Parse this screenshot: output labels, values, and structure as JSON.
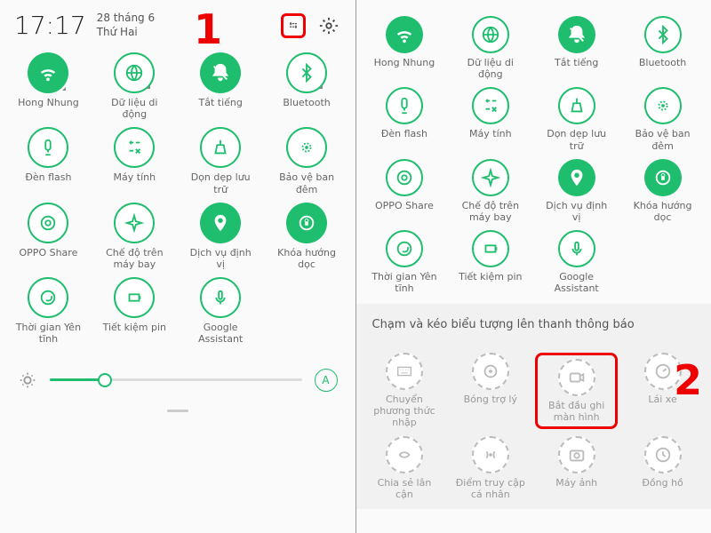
{
  "status": {
    "time": "17:17",
    "date1": "28 tháng 6",
    "date2": "Thứ Hai"
  },
  "tiles_left": [
    {
      "label": "Hong Nhung",
      "filled": true,
      "icon": "wifi",
      "corner": true
    },
    {
      "label": "Dữ liệu di động",
      "filled": false,
      "icon": "globe",
      "corner": true
    },
    {
      "label": "Tắt tiếng",
      "filled": true,
      "icon": "bell-off",
      "corner": false
    },
    {
      "label": "Bluetooth",
      "filled": false,
      "icon": "bt",
      "corner": true
    },
    {
      "label": "Đèn flash",
      "filled": false,
      "icon": "flash",
      "corner": false
    },
    {
      "label": "Máy tính",
      "filled": false,
      "icon": "calc",
      "corner": false
    },
    {
      "label": "Dọn dẹp lưu trữ",
      "filled": false,
      "icon": "sweep",
      "corner": false
    },
    {
      "label": "Bảo vệ ban đêm",
      "filled": false,
      "icon": "night",
      "corner": false
    },
    {
      "label": "OPPO Share",
      "filled": false,
      "icon": "share",
      "corner": false
    },
    {
      "label": "Chế độ trên máy bay",
      "filled": false,
      "icon": "plane",
      "corner": false
    },
    {
      "label": "Dịch vụ định vị",
      "filled": true,
      "icon": "loc",
      "corner": false
    },
    {
      "label": "Khóa hướng dọc",
      "filled": true,
      "icon": "lock-rot",
      "corner": false
    },
    {
      "label": "Thời gian Yên tĩnh",
      "filled": false,
      "icon": "dnd",
      "corner": false
    },
    {
      "label": "Tiết kiệm pin",
      "filled": false,
      "icon": "battery",
      "corner": false
    },
    {
      "label": "Google Assistant",
      "filled": false,
      "icon": "mic",
      "corner": false
    }
  ],
  "tiles_right": [
    {
      "label": "Hong Nhung",
      "filled": true,
      "icon": "wifi"
    },
    {
      "label": "Dữ liệu di động",
      "filled": false,
      "icon": "globe"
    },
    {
      "label": "Tắt tiếng",
      "filled": true,
      "icon": "bell-off"
    },
    {
      "label": "Bluetooth",
      "filled": false,
      "icon": "bt"
    },
    {
      "label": "Đèn flash",
      "filled": false,
      "icon": "flash"
    },
    {
      "label": "Máy tính",
      "filled": false,
      "icon": "calc"
    },
    {
      "label": "Dọn dẹp lưu trữ",
      "filled": false,
      "icon": "sweep"
    },
    {
      "label": "Bảo vệ ban đêm",
      "filled": false,
      "icon": "night"
    },
    {
      "label": "OPPO Share",
      "filled": false,
      "icon": "share"
    },
    {
      "label": "Chế độ trên máy bay",
      "filled": false,
      "icon": "plane"
    },
    {
      "label": "Dịch vụ định vị",
      "filled": true,
      "icon": "loc"
    },
    {
      "label": "Khóa hướng dọc",
      "filled": true,
      "icon": "lock-rot"
    },
    {
      "label": "Thời gian Yên tĩnh",
      "filled": false,
      "icon": "dnd"
    },
    {
      "label": "Tiết kiệm pin",
      "filled": false,
      "icon": "battery"
    },
    {
      "label": "Google Assistant",
      "filled": false,
      "icon": "mic"
    }
  ],
  "tray_hint": "Chạm và kéo biểu tượng lên thanh thông báo",
  "tray_tiles": [
    {
      "label": "Chuyển phương thức nhập",
      "icon": "kbd"
    },
    {
      "label": "Bóng trợ lý",
      "icon": "bubble"
    },
    {
      "label": "Bắt đầu ghi màn hình",
      "icon": "record",
      "highlight": true
    },
    {
      "label": "Lái xe",
      "icon": "car"
    },
    {
      "label": "Chia sẻ lân cận",
      "icon": "nearby"
    },
    {
      "label": "Điểm truy cập cá nhân",
      "icon": "hotspot"
    },
    {
      "label": "Máy ảnh",
      "icon": "camera"
    },
    {
      "label": "Đồng hồ",
      "icon": "clock"
    }
  ],
  "auto": "A",
  "step1": "1",
  "step2": "2"
}
